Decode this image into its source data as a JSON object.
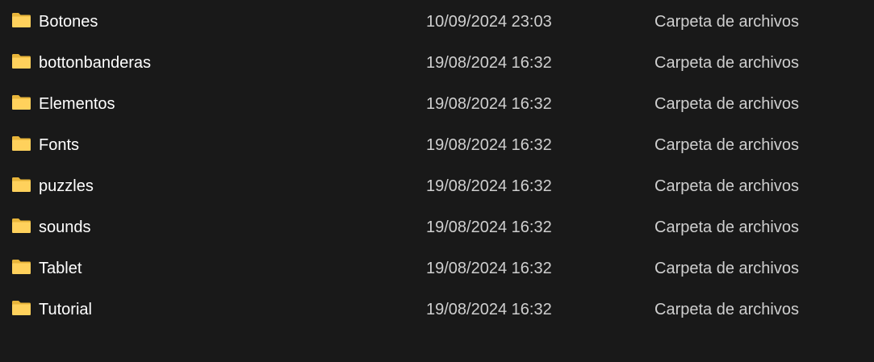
{
  "files": [
    {
      "name": "Botones",
      "date": "10/09/2024 23:03",
      "type": "Carpeta de archivos",
      "icon": "folder-icon"
    },
    {
      "name": "bottonbanderas",
      "date": "19/08/2024 16:32",
      "type": "Carpeta de archivos",
      "icon": "folder-icon"
    },
    {
      "name": "Elementos",
      "date": "19/08/2024 16:32",
      "type": "Carpeta de archivos",
      "icon": "folder-icon"
    },
    {
      "name": "Fonts",
      "date": "19/08/2024 16:32",
      "type": "Carpeta de archivos",
      "icon": "folder-icon"
    },
    {
      "name": "puzzles",
      "date": "19/08/2024 16:32",
      "type": "Carpeta de archivos",
      "icon": "folder-icon"
    },
    {
      "name": "sounds",
      "date": "19/08/2024 16:32",
      "type": "Carpeta de archivos",
      "icon": "folder-icon"
    },
    {
      "name": "Tablet",
      "date": "19/08/2024 16:32",
      "type": "Carpeta de archivos",
      "icon": "folder-icon"
    },
    {
      "name": "Tutorial",
      "date": "19/08/2024 16:32",
      "type": "Carpeta de archivos",
      "icon": "folder-icon"
    }
  ],
  "colors": {
    "background": "#191919",
    "name_text": "#ffffff",
    "meta_text": "#cfcfcf",
    "folder_back": "#e8b53a",
    "folder_front": "#ffd15c"
  }
}
